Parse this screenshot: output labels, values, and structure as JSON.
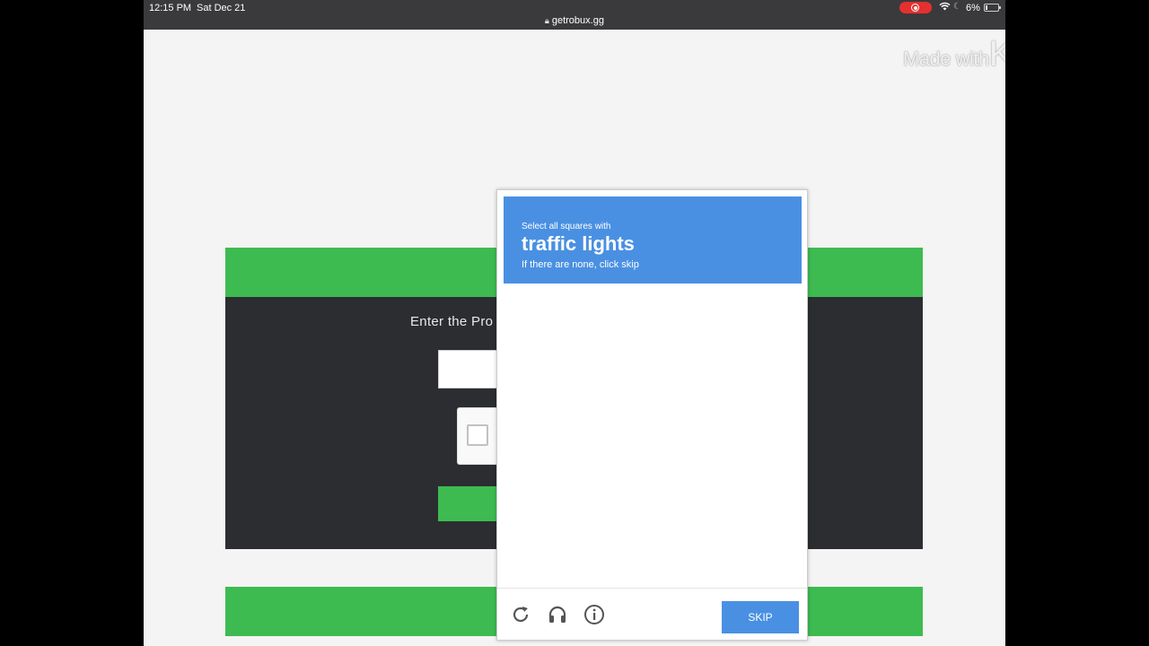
{
  "status_bar": {
    "time": "12:15 PM",
    "date": "Sat Dec 21",
    "url": "getrobux.gg",
    "battery": "6%"
  },
  "watermark": {
    "made_with": "Made with",
    "brand": "KINEMASTER"
  },
  "page": {
    "enter_label": "Enter the Pro"
  },
  "captcha": {
    "instruction": "Select all squares with",
    "target": "traffic lights",
    "hint": "If there are none, click skip",
    "skip_label": "SKIP",
    "icons": [
      "reload-icon",
      "audio-icon",
      "info-icon"
    ],
    "header_color": "#4a90e2"
  },
  "colors": {
    "green": "#3dbb51",
    "dark_panel": "#2b2d31",
    "accent": "#4a90e2"
  }
}
